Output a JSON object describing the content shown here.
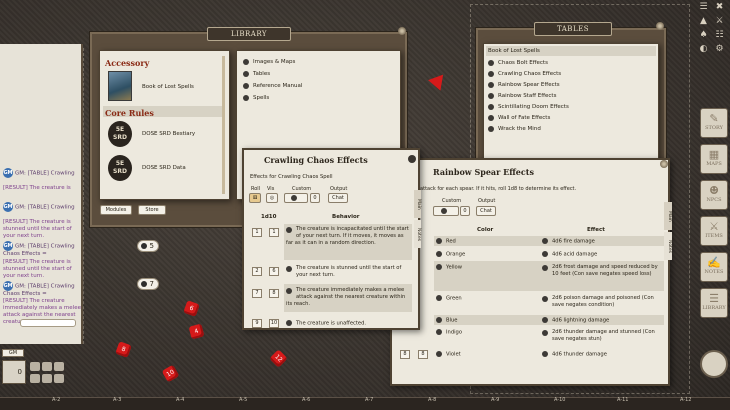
{
  "library": {
    "title": "LIBRARY",
    "categories": [
      {
        "label": "Accessory",
        "items": [
          {
            "label": "Book of Lost Spells"
          }
        ]
      },
      {
        "label": "Core Rules",
        "items": [
          {
            "label": "DOSE SRD Bestiary",
            "badge": "5E SRD"
          },
          {
            "label": "DOSE SRD Data",
            "badge": "5E SRD"
          }
        ]
      }
    ],
    "nav": [
      "Images & Maps",
      "Tables",
      "Reference Manual",
      "Spells"
    ],
    "buttons": {
      "modules": "Modules",
      "store": "Store"
    }
  },
  "tables": {
    "title": "TABLES",
    "items": [
      "Book of Lost Spells",
      "Chaos Bolt Effects",
      "Crawling Chaos Effects",
      "Rainbow Spear Effects",
      "Rainbow Staff Effects",
      "Scintillating Doom Effects",
      "Wall of Fate Effects",
      "Wrack the Mind"
    ]
  },
  "crawling": {
    "title": "Crawling Chaos Effects",
    "subtitle": "Effects for Crawling Chaos Spell",
    "controls": {
      "roll": "Roll",
      "vis": "Vis",
      "custom": "Custom",
      "output": "Output",
      "custom_value": "0",
      "chat": "Chat"
    },
    "columns": [
      "1d10",
      "Behavior"
    ],
    "rows": [
      {
        "from": "1",
        "to": "1",
        "text": "The creature is incapacitated until the start of your next turn. If it moves, it moves as far as it can in a random direction."
      },
      {
        "from": "2",
        "to": "6",
        "text": "The creature is stunned until the start of your next turn."
      },
      {
        "from": "7",
        "to": "8",
        "text": "The creature immediately makes a melee attack against the nearest creature within its reach."
      },
      {
        "from": "9",
        "to": "10",
        "text": "The creature is unaffected."
      }
    ],
    "side_tabs": [
      "Main",
      "Notes"
    ]
  },
  "rainbow": {
    "title": "Rainbow Spear Effects",
    "subtitle": "ed spell attack for each spear. If it hits, roll 1d8 to determine its effect.",
    "controls": {
      "custom": "Custom",
      "output": "Output",
      "custom_value": "0",
      "chat": "Chat"
    },
    "columns": [
      "Color",
      "Effect"
    ],
    "rows": [
      {
        "color": "Red",
        "effect": "4d6 fire damage"
      },
      {
        "color": "Orange",
        "effect": "4d6 acid damage"
      },
      {
        "color": "Yellow",
        "effect": "2d6 frost damage and speed reduced by 10 feet (Con save negates speed loss)"
      },
      {
        "color": "Green",
        "effect": "2d6 poison damage and poisoned (Con save negates condition)"
      },
      {
        "color": "Blue",
        "effect": "4d6 lightning damage"
      },
      {
        "color": "Indigo",
        "effect": "2d6 thunder damage and stunned (Con save negates stun)"
      },
      {
        "from": "8",
        "to": "8",
        "color": "Violet",
        "effect": "4d6 thunder damage"
      }
    ],
    "side_tabs": [
      "Main",
      "Notes"
    ]
  },
  "chat": {
    "lines": [
      {
        "kind": "gm",
        "text": "GM: [TABLE] Crawling"
      },
      {
        "kind": "result",
        "text": "[RESULT] The creature is"
      },
      {
        "kind": "gm",
        "text": "GM: [TABLE] Crawling"
      },
      {
        "kind": "result",
        "text": "[RESULT] The creature is stunned until the start of your next turn."
      },
      {
        "kind": "gm",
        "text": "GM: [TABLE] Crawling Chaos Effects =",
        "die": "5"
      },
      {
        "kind": "result",
        "text": "[RESULT] The creature is stunned until the start of your next turn."
      },
      {
        "kind": "gm",
        "text": "GM: [TABLE] Crawling Chaos Effects =",
        "die": "7"
      },
      {
        "kind": "result",
        "text": "[RESULT] The creature immediately makes a melee attack against the nearest creature within its reach."
      }
    ],
    "gm_label": "GM",
    "identity": "GM",
    "modifier": "0"
  },
  "sidebar": [
    "STORY",
    "MAPS",
    "NPCS",
    "ITEMS",
    "NOTES",
    "LIBRARY"
  ],
  "ruler": [
    "A-2",
    "A-3",
    "A-4",
    "A-5",
    "A-6",
    "A-7",
    "A-8",
    "A-9",
    "A-10",
    "A-11",
    "A-12"
  ],
  "dice_red": [
    "6",
    "4",
    "8",
    "12",
    "10"
  ]
}
